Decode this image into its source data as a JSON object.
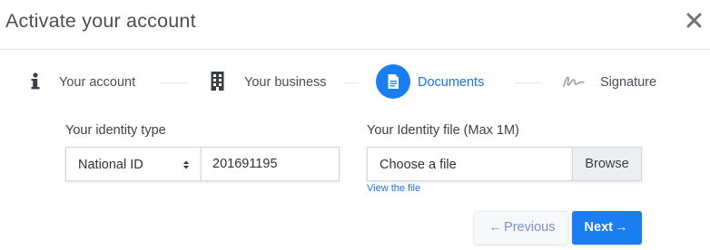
{
  "modal": {
    "title": "Activate your account"
  },
  "steps": [
    {
      "label": "Your account",
      "icon": "info-icon",
      "active": false
    },
    {
      "label": "Your business",
      "icon": "building-icon",
      "active": false
    },
    {
      "label": "Documents",
      "icon": "document-icon",
      "active": true
    },
    {
      "label": "Signature",
      "icon": "signature-icon",
      "active": false
    }
  ],
  "form": {
    "identity_type_label": "Your identity type",
    "identity_type_value": "National ID",
    "identity_number": "201691195",
    "identity_file_label": "Your Identity file (Max 1M)",
    "file_placeholder": "Choose a file",
    "browse_label": "Browse",
    "view_file_link": "View the file"
  },
  "actions": {
    "previous_arrow": "←",
    "previous_label": "Previous",
    "next_label": "Next",
    "next_arrow": "→"
  },
  "colors": {
    "accent": "#1a7ef0",
    "previous_text": "#7b8cdc",
    "browse_bg": "#eceef1"
  }
}
